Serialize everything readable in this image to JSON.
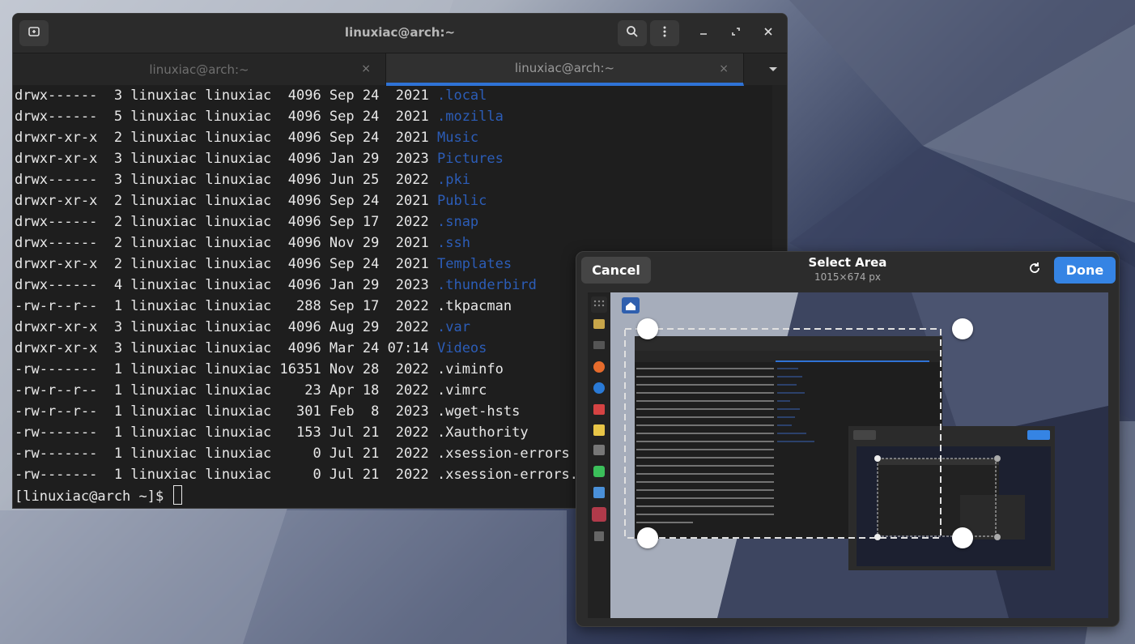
{
  "terminal": {
    "title": "linuxiac@arch:~",
    "tabs": [
      {
        "label": "linuxiac@arch:~",
        "close": "×",
        "active": false
      },
      {
        "label": "linuxiac@arch:~",
        "close": "×",
        "active": true
      }
    ],
    "lines": [
      {
        "meta": "drwx------  3 linuxiac linuxiac  4096 Sep 24  2021 ",
        "name": ".local",
        "is_dir": true
      },
      {
        "meta": "drwx------  5 linuxiac linuxiac  4096 Sep 24  2021 ",
        "name": ".mozilla",
        "is_dir": true
      },
      {
        "meta": "drwxr-xr-x  2 linuxiac linuxiac  4096 Sep 24  2021 ",
        "name": "Music",
        "is_dir": true
      },
      {
        "meta": "drwxr-xr-x  3 linuxiac linuxiac  4096 Jan 29  2023 ",
        "name": "Pictures",
        "is_dir": true
      },
      {
        "meta": "drwx------  3 linuxiac linuxiac  4096 Jun 25  2022 ",
        "name": ".pki",
        "is_dir": true
      },
      {
        "meta": "drwxr-xr-x  2 linuxiac linuxiac  4096 Sep 24  2021 ",
        "name": "Public",
        "is_dir": true
      },
      {
        "meta": "drwx------  2 linuxiac linuxiac  4096 Sep 17  2022 ",
        "name": ".snap",
        "is_dir": true
      },
      {
        "meta": "drwx------  2 linuxiac linuxiac  4096 Nov 29  2021 ",
        "name": ".ssh",
        "is_dir": true
      },
      {
        "meta": "drwxr-xr-x  2 linuxiac linuxiac  4096 Sep 24  2021 ",
        "name": "Templates",
        "is_dir": true
      },
      {
        "meta": "drwx------  4 linuxiac linuxiac  4096 Jan 29  2023 ",
        "name": ".thunderbird",
        "is_dir": true
      },
      {
        "meta": "-rw-r--r--  1 linuxiac linuxiac   288 Sep 17  2022 ",
        "name": ".tkpacman",
        "is_dir": false
      },
      {
        "meta": "drwxr-xr-x  3 linuxiac linuxiac  4096 Aug 29  2022 ",
        "name": ".var",
        "is_dir": true
      },
      {
        "meta": "drwxr-xr-x  3 linuxiac linuxiac  4096 Mar 24 07:14 ",
        "name": "Videos",
        "is_dir": true
      },
      {
        "meta": "-rw-------  1 linuxiac linuxiac 16351 Nov 28  2022 ",
        "name": ".viminfo",
        "is_dir": false
      },
      {
        "meta": "-rw-r--r--  1 linuxiac linuxiac    23 Apr 18  2022 ",
        "name": ".vimrc",
        "is_dir": false
      },
      {
        "meta": "-rw-r--r--  1 linuxiac linuxiac   301 Feb  8  2023 ",
        "name": ".wget-hsts",
        "is_dir": false
      },
      {
        "meta": "-rw-------  1 linuxiac linuxiac   153 Jul 21  2022 ",
        "name": ".Xauthority",
        "is_dir": false
      },
      {
        "meta": "-rw-------  1 linuxiac linuxiac     0 Jul 21  2022 ",
        "name": ".xsession-errors",
        "is_dir": false
      },
      {
        "meta": "-rw-------  1 linuxiac linuxiac     0 Jul 21  2022 ",
        "name": ".xsession-errors.ol",
        "is_dir": false
      }
    ],
    "prompt": "[linuxiac@arch ~]$ ",
    "icons": {
      "new_tab": "new-tab-icon",
      "search": "search-icon",
      "menu": "kebab-menu-icon",
      "minimize": "minimize-icon",
      "maximize": "maximize-icon",
      "close": "close-icon",
      "tab_dropdown": "chevron-down-icon"
    }
  },
  "screenshot_dialog": {
    "cancel_label": "Cancel",
    "title": "Select Area",
    "subtitle": "1015×674 px",
    "done_label": "Done",
    "refresh_icon": "refresh-icon"
  },
  "colors": {
    "accent": "#3584e4",
    "dir_link": "#2c5db8",
    "tab_indicator": "#2f73d6"
  }
}
